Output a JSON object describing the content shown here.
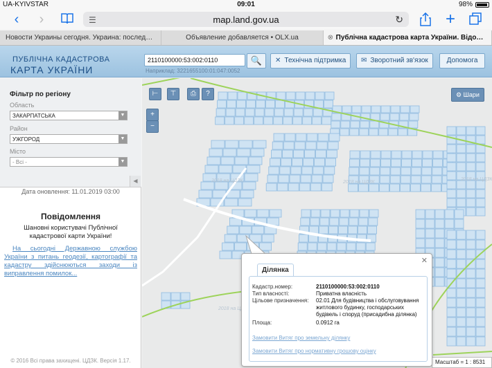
{
  "status": {
    "carrier": "UA-KYIVSTAR",
    "time": "09:01",
    "battery": "98%"
  },
  "browser": {
    "url": "map.land.gov.ua",
    "tabs": [
      "Новости Украины сегодня. Украина: последни...",
      "Объявление добавляется • OLX.ua",
      "Публічна кадастрова карта України. Відомо..."
    ]
  },
  "header": {
    "logo_line1": "ПУБЛІЧНА КАДАСТРОВА",
    "logo_line2": "КАРТА УКРАЇНИ",
    "search_value": "2110100000:53:002:0110",
    "search_hint": "Наприклад: 3221655100:01:047:0052",
    "support_label": "Технічна підтримка",
    "feedback_label": "Зворотний зв'язок",
    "help_label": "Допомога"
  },
  "filter": {
    "title": "Фільтр по регіону",
    "region_label": "Область",
    "region_value": "ЗАКАРПАТСЬКА",
    "district_label": "Район",
    "district_value": "УЖГОРОД",
    "city_label": "Місто",
    "city_value": "- Всі -"
  },
  "sidebar": {
    "updated": "Дата оновлення: 11.01.2019 03:00",
    "notice_title": "Повідомлення",
    "notice_body": "Шановні користувачі Публічної кадастрової карти України!",
    "notice_link": "На сьогодні Державною службою України з питань геодезії, картографії та кадастру здійснюються заходи із виправлення помилок...",
    "footer": "© 2016 Всі права захищені. ЦДЗК. Версія 1.17."
  },
  "map": {
    "layers_label": "Шари",
    "scale": "Масштаб = 1 : 8531",
    "watermark": "2018 на ЦДЗК"
  },
  "popup": {
    "tab": "Ділянка",
    "rows": [
      {
        "label": "Кадастр.номер:",
        "value": "2110100000:53:002:0110"
      },
      {
        "label": "Тип власності:",
        "value": "Приватна власність"
      },
      {
        "label": "Цільове призначення:",
        "value": "02.01 Для будівництва і обслуговування житлового будинку, господарських будівель і споруд (присадибна ділянка)"
      },
      {
        "label": "Площа:",
        "value": "0.0912 га"
      }
    ],
    "link1": "Замовити Витяг про земельну ділянку",
    "link2": "Замовити Витяг про нормативну грошову оцінку"
  },
  "colors": {
    "parcel_fill": "#cfe3f3",
    "parcel_stroke": "#8fbbe0",
    "boundary": "#9dd35a",
    "header_bg": "#a9cce6"
  }
}
